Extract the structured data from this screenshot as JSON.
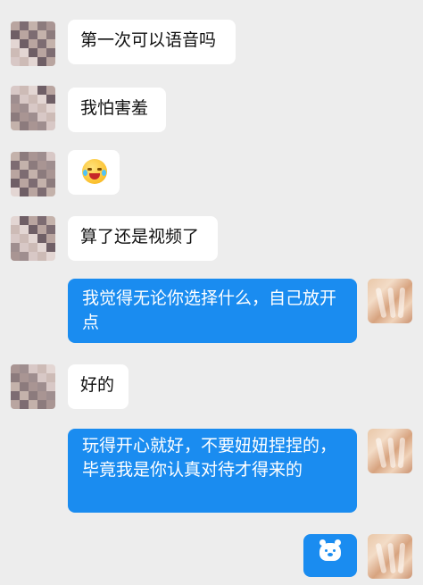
{
  "messages": [
    {
      "side": "left",
      "type": "text",
      "text": "第一次可以语音吗"
    },
    {
      "side": "left",
      "type": "text",
      "text": "我怕害羞"
    },
    {
      "side": "left",
      "type": "emoji",
      "icon": "laughing-crying-emoji-icon"
    },
    {
      "side": "left",
      "type": "text",
      "text": "算了还是视频了"
    },
    {
      "side": "right",
      "type": "text",
      "text": "我觉得无论你选择什么，自己放开点"
    },
    {
      "side": "left",
      "type": "text",
      "text": "好的"
    },
    {
      "side": "right",
      "type": "text",
      "text": "玩得开心就好，不要妞妞捏捏的，毕竟我是你认真对待才得来的"
    },
    {
      "side": "right",
      "type": "sticker",
      "icon": "bear-sticker-icon"
    }
  ],
  "colors": {
    "background": "#ededed",
    "left_bubble": "#ffffff",
    "right_bubble": "#1a8cf0",
    "text_dark": "#111111",
    "text_light": "#ffffff"
  }
}
